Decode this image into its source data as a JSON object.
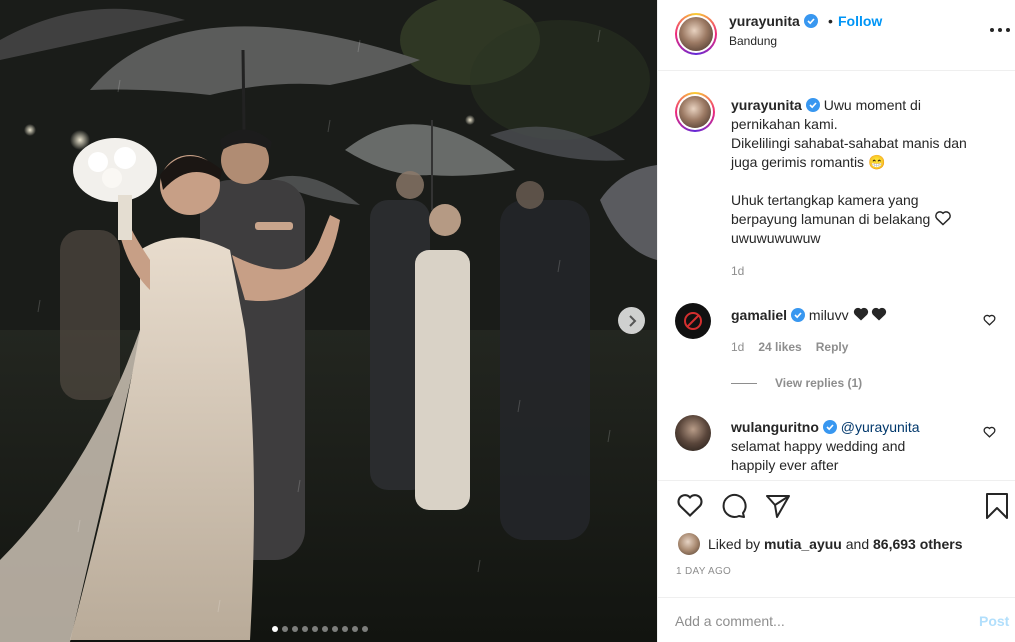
{
  "post": {
    "carousel": {
      "total_slides": 10,
      "active_slide": 1
    }
  },
  "header": {
    "username": "yurayunita",
    "separator": "•",
    "follow_label": "Follow",
    "location": "Bandung"
  },
  "caption": {
    "username": "yurayunita",
    "line1": "Uwu moment di",
    "line2": "pernikahan kami.",
    "line3": "Dikelilingi sahabat-sahabat manis dan",
    "line4": "juga gerimis romantis 😁",
    "line5": "Uhuk tertangkap kamera yang",
    "line6": "berpayung lamunan di belakang",
    "line7": "uwuwuwuwuw",
    "time": "1d"
  },
  "comments": [
    {
      "username": "gamaliel",
      "text": "miluvv",
      "time": "1d",
      "likes": "24 likes",
      "reply_label": "Reply",
      "view_replies": "View replies (1)"
    },
    {
      "username": "wulanguritno",
      "mention": "@yurayunita",
      "line1": "selamat happy wedding and",
      "line2": "happily ever after"
    }
  ],
  "liked_by": {
    "prefix": "Liked by",
    "user": "mutia_ayuu",
    "middle": "and",
    "others": "86,693 others"
  },
  "post_date": "1 DAY AGO",
  "add_comment": {
    "placeholder": "Add a comment...",
    "post_label": "Post"
  },
  "colors": {
    "link_blue": "#0095f6",
    "verified_blue": "#3897f0",
    "post_disabled": "#b2dffc",
    "muted": "#8e8e8e"
  }
}
